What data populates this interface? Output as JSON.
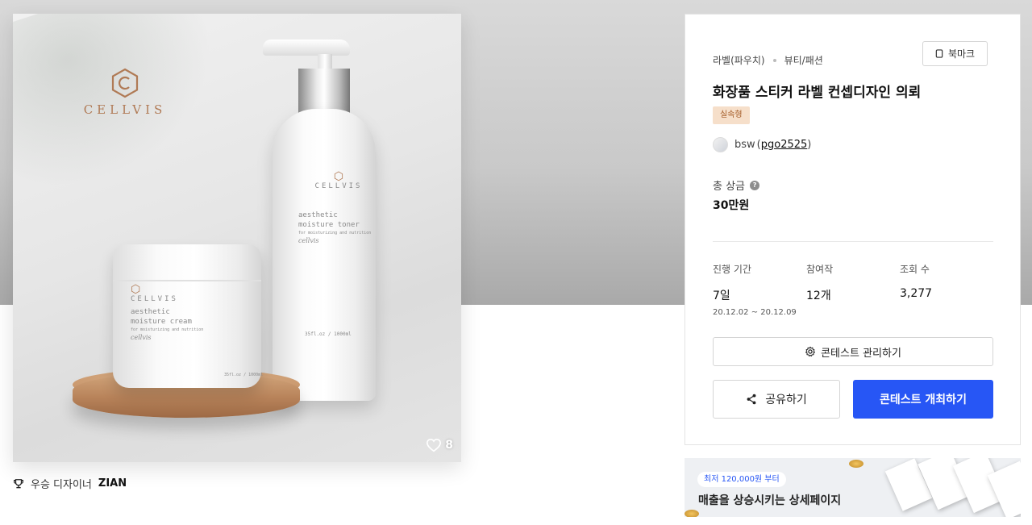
{
  "product": {
    "brand": "CELLVIS",
    "bottle_label": [
      "CELLVIS",
      "aesthetic",
      "moisture toner",
      "for moisturizing and nutrition",
      "cellvis",
      "35fl.oz / 1000ml"
    ],
    "jar_label": [
      "CELLVIS",
      "aesthetic",
      "moisture cream",
      "for moisturizing and nutrition",
      "cellvis",
      "35fl.oz / 1000ml"
    ],
    "like_count": "8"
  },
  "winner": {
    "label": "우승 디자이너",
    "name": "ZIAN"
  },
  "info": {
    "category": "라벨(파우치)",
    "subcategory": "뷰티/패션",
    "bookmark_label": "북마크",
    "title": "화장품 스티커 라벨 컨셉디자인 의뢰",
    "badge": "실속형",
    "host_name": "bsw",
    "host_id": "pgo2525",
    "prize_label": "총 상금",
    "prize_value": "30만원",
    "stats": {
      "period_label": "진행 기간",
      "period_value": "7일",
      "period_range": "20.12.02 ~ 20.12.09",
      "entries_label": "참여작",
      "entries_value": "12개",
      "views_label": "조회 수",
      "views_value": "3,277"
    },
    "manage_label": "콘테스트 관리하기",
    "share_label": "공유하기",
    "host_contest_label": "콘테스트 개최하기"
  },
  "ad": {
    "pill": "최저 120,000원 부터",
    "title": "매출을 상승시키는 상세페이지"
  },
  "colors": {
    "primary": "#2756f5",
    "badge_bg": "#f6dfca",
    "badge_text": "#a35a25",
    "brand_copper": "#b07a55"
  }
}
